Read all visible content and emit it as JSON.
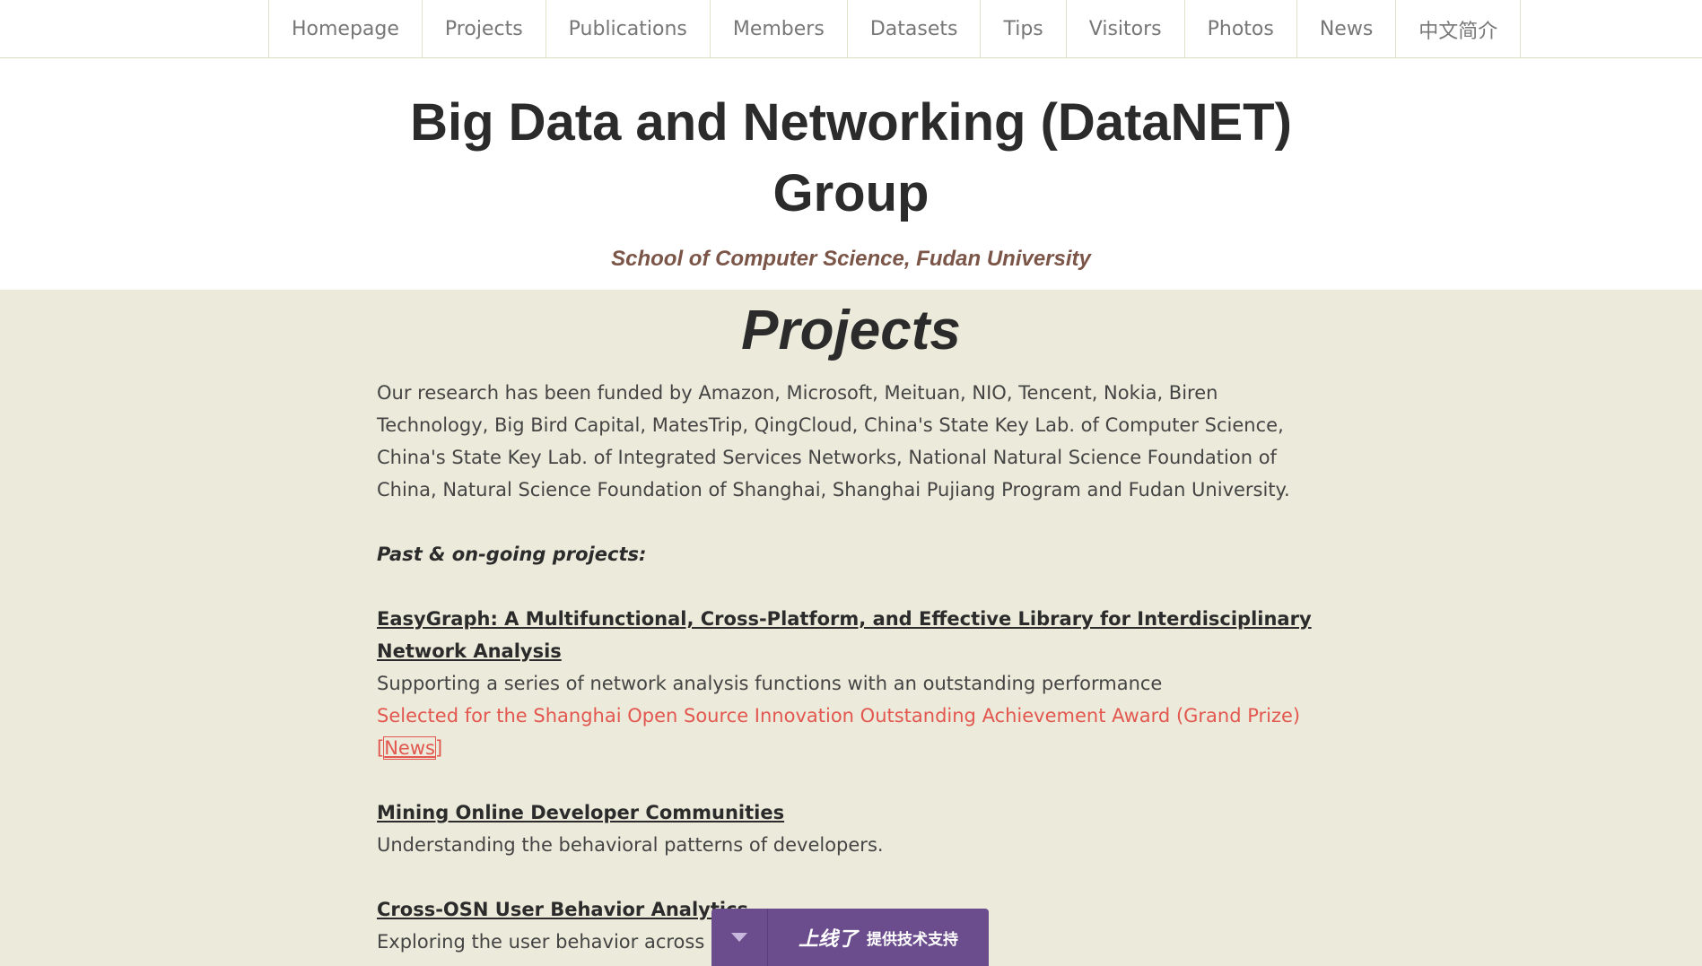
{
  "nav": {
    "items": [
      "Homepage",
      "Projects",
      "Publications",
      "Members",
      "Datasets",
      "Tips",
      "Visitors",
      "Photos",
      "News",
      "中文简介"
    ]
  },
  "header": {
    "title_line1": "Big Data and Networking (DataNET)",
    "title_line2": "Group",
    "subtitle": "School of Computer Science, Fudan University"
  },
  "main": {
    "page_title": "Projects",
    "intro": "Our research has been funded by Amazon, Microsoft, Meituan, NIO, Tencent, Nokia, Biren Technology, Big Bird Capital, MatesTrip, QingCloud, China's State Key Lab. of Computer Science, China's State Key Lab. of Integrated Services Networks, National Natural Science Foundation of China, Natural Science Foundation of Shanghai, Shanghai Pujiang Program and Fudan University.",
    "section_label": "Past & on-going projects:",
    "projects": [
      {
        "title": "EasyGraph: A Multifunctional, Cross-Platform, and Effective Library for Interdisciplinary Network Analysis",
        "desc": "Supporting a series of network analysis functions with an outstanding performance",
        "award": "Selected for the Shanghai Open Source Innovation Outstanding Achievement Award (Grand Prize) ",
        "award_link_open": "[",
        "award_link": "News",
        "award_link_close": "]"
      },
      {
        "title": "Mining Online Developer Communities",
        "desc": "Understanding the behavioral patterns of developers."
      },
      {
        "title": "Cross-OSN User Behavior Analytics",
        "desc": "Exploring the user behavior across multiple OSNs."
      }
    ]
  },
  "support_bar": {
    "brand": "上线了",
    "label": "提供技术支持"
  },
  "colors": {
    "nav_text": "#777777",
    "title": "#2b2b2b",
    "subtitle": "#7a5548",
    "main_bg": "#ecebdb",
    "award": "#e2574f",
    "support_bg": "#6b4d8d"
  },
  "icons": {
    "support_toggle": "chevron-down-icon"
  }
}
